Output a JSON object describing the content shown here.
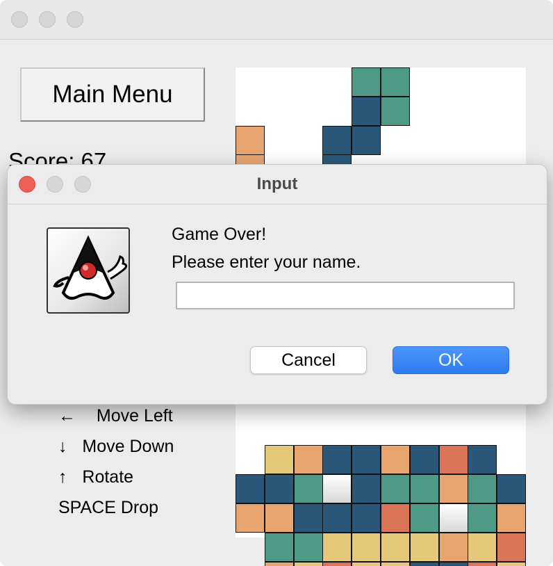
{
  "main_window": {
    "main_menu_label": "Main Menu",
    "score_text": "Score: 67"
  },
  "controls": [
    {
      "key": "←",
      "action": "Move Left"
    },
    {
      "key": "↓",
      "action": "Move Down"
    },
    {
      "key": "↑",
      "action": "Rotate"
    },
    {
      "key": "SPACE",
      "action": "Drop"
    }
  ],
  "dialog": {
    "title": "Input",
    "line1": "Game Over!",
    "line2": "Please enter your name.",
    "name_value": "",
    "cancel_label": "Cancel",
    "ok_label": "OK",
    "icon": "java-duke-icon"
  },
  "colors": {
    "teal": "#4f9a87",
    "navy": "#2b5878",
    "orange": "#e8a56f",
    "yellow": "#e4c97b",
    "red": "#d97459",
    "ok_blue": "#3583f7",
    "close_red": "#ee5f57"
  }
}
